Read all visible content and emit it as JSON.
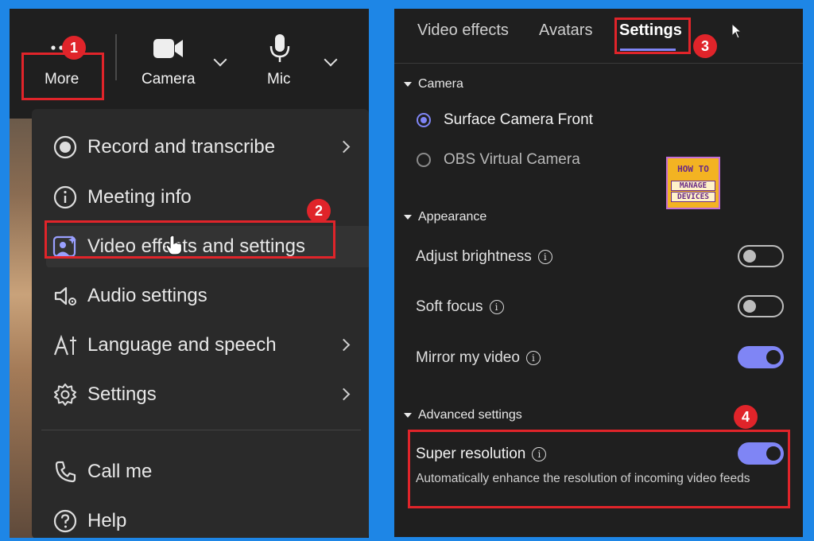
{
  "left": {
    "toolbar": {
      "more_label": "More",
      "camera_label": "Camera",
      "mic_label": "Mic"
    },
    "menu": {
      "items": [
        {
          "label": "Record and transcribe",
          "icon": "record-icon",
          "has_submenu": true
        },
        {
          "label": "Meeting info",
          "icon": "info-icon",
          "has_submenu": false
        },
        {
          "label": "Video effects and settings",
          "icon": "video-effects-icon",
          "has_submenu": false
        },
        {
          "label": "Audio settings",
          "icon": "audio-settings-icon",
          "has_submenu": false
        },
        {
          "label": "Language and speech",
          "icon": "language-icon",
          "has_submenu": true
        },
        {
          "label": "Settings",
          "icon": "gear-icon",
          "has_submenu": true
        },
        {
          "label": "Call me",
          "icon": "phone-icon",
          "has_submenu": false
        },
        {
          "label": "Help",
          "icon": "help-icon",
          "has_submenu": false
        }
      ]
    }
  },
  "right": {
    "tabs": [
      {
        "label": "Video effects"
      },
      {
        "label": "Avatars"
      },
      {
        "label": "Settings",
        "selected": true
      }
    ],
    "camera": {
      "heading": "Camera",
      "options": [
        {
          "label": "Surface Camera Front",
          "selected": true
        },
        {
          "label": "OBS Virtual Camera",
          "selected": false
        }
      ]
    },
    "appearance": {
      "heading": "Appearance",
      "settings": [
        {
          "label": "Adjust brightness",
          "enabled": false
        },
        {
          "label": "Soft focus",
          "enabled": false
        },
        {
          "label": "Mirror my video",
          "enabled": true
        }
      ]
    },
    "advanced": {
      "heading": "Advanced settings",
      "super_resolution": {
        "label": "Super resolution",
        "enabled": true,
        "description": "Automatically enhance the resolution of incoming video feeds"
      }
    }
  },
  "logo": {
    "line1": "HOW TO",
    "line2": "MANAGE",
    "line3": "DEVICES"
  },
  "callouts": [
    "1",
    "2",
    "3",
    "4"
  ],
  "colors": {
    "accent": "#7f85f5",
    "highlight": "#e0242a",
    "background": "#1e86e6",
    "panel": "#1f1f1f"
  }
}
